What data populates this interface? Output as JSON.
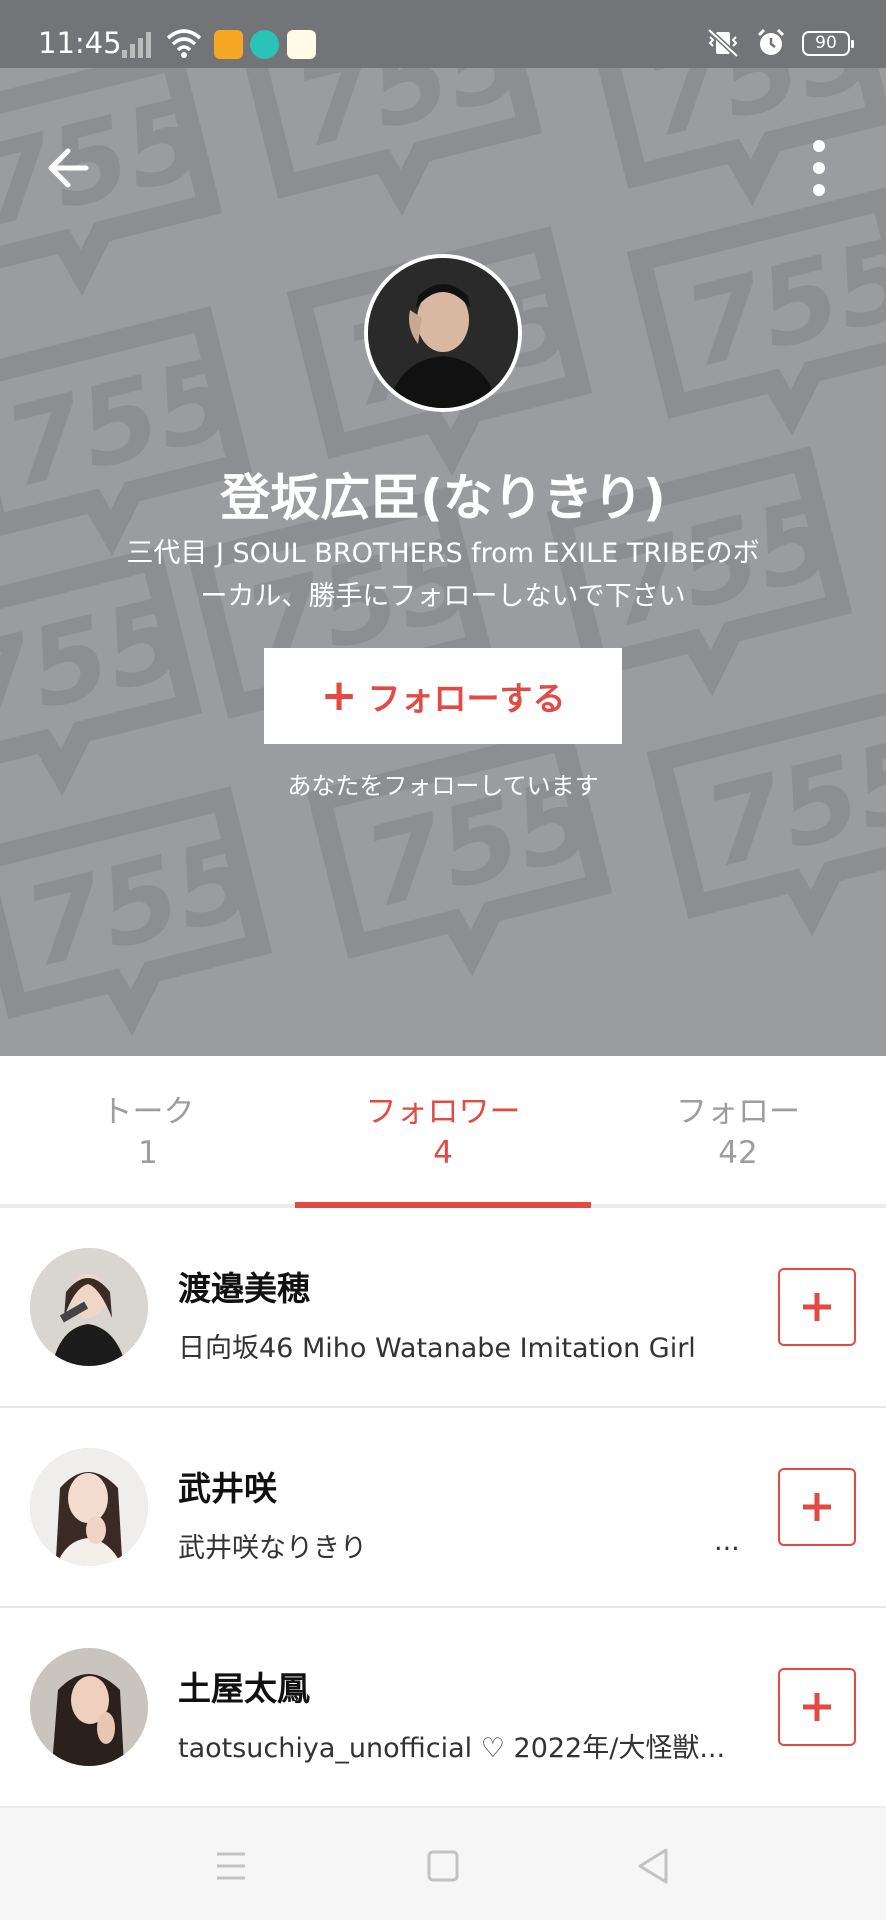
{
  "status_bar": {
    "time": "11:45",
    "battery": "90"
  },
  "profile": {
    "name": "登坂広臣(なりきり)",
    "bio_line1": "三代目 J SOUL BROTHERS from EXILE TRIBEのボ",
    "bio_line2": "ーカル、勝手にフォローしないで下さい",
    "follow_label": "フォローする",
    "follows_you_text": "あなたをフォローしています",
    "background_watermark": "755"
  },
  "tabs": [
    {
      "label": "トーク",
      "count": "1"
    },
    {
      "label": "フォロワー",
      "count": "4"
    },
    {
      "label": "フォロー",
      "count": "42"
    }
  ],
  "followers": [
    {
      "name": "渡邉美穂",
      "description": "日向坂46 Miho Watanabe Imitation Girl",
      "ellipsis": ""
    },
    {
      "name": "武井咲",
      "description": "武井咲なりきり",
      "ellipsis": "..."
    },
    {
      "name": "土屋太鳳",
      "description": "taotsuchiya_unofficial ♡ 2022年/大怪獣...",
      "ellipsis": ""
    }
  ],
  "colors": {
    "accent": "#e24a44",
    "hero_bg": "#9a9c9f",
    "status_bar_bg": "#727477"
  },
  "icons": {
    "back": "arrow-left-icon",
    "more": "more-vertical-icon",
    "add": "plus-icon",
    "nav_menu": "menu-icon",
    "nav_home": "square-home-icon",
    "nav_back": "triangle-back-icon"
  }
}
